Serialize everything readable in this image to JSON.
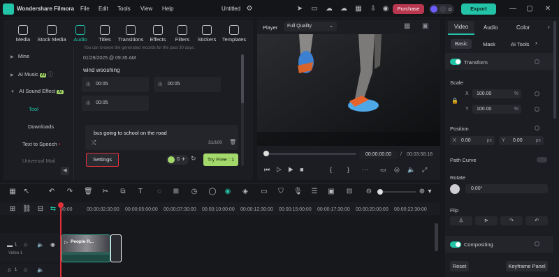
{
  "app": {
    "name": "Wondershare Filmora",
    "title": "Untitled"
  },
  "menu": [
    "File",
    "Edit",
    "Tools",
    "View",
    "Help"
  ],
  "header": {
    "purchase": "Purchase",
    "credits": "0",
    "export": "Export"
  },
  "media_nav": [
    "Media",
    "Stock Media",
    "Audio",
    "Titles",
    "Transitions",
    "Effects",
    "Filters",
    "Stickers",
    "Templates"
  ],
  "sidebar": {
    "items": [
      {
        "label": "Mine"
      },
      {
        "label": "AI Music",
        "badge": "AI"
      },
      {
        "label": "AI Sound Effect",
        "badge": "AI"
      },
      {
        "label": "Tool"
      },
      {
        "label": "Downloads"
      },
      {
        "label": "Text to Speech"
      },
      {
        "label": "Universal Mail"
      }
    ]
  },
  "content": {
    "note": "You can browse the generated records for the past 30 days.",
    "date": "01/29/2025 @ 09:35 AM",
    "record_title": "wind wooshing",
    "clips": [
      "00:05",
      "00:05",
      "00:05"
    ],
    "prompt": "bus going to school on the road",
    "counter": "31/100",
    "settings": "Settings",
    "credit_cost": "0",
    "try_free": "Try Free : 1"
  },
  "player": {
    "label": "Player",
    "quality": "Full Quality",
    "current_time": "00:00:00:00",
    "separator": "/",
    "duration": "00:03:58:18"
  },
  "right_panel": {
    "tabs": [
      "Video",
      "Audio",
      "Color"
    ],
    "subtabs": [
      "Basic",
      "Mask",
      "AI Tools"
    ],
    "transform": "Transform",
    "scale": "Scale",
    "scale_x_label": "X",
    "scale_y_label": "Y",
    "scale_x": "100.00",
    "scale_y": "100.00",
    "percent": "%",
    "position": "Position",
    "pos_x_label": "X",
    "pos_y_label": "Y",
    "pos_x": "0.00",
    "pos_y": "0.00",
    "px": "px",
    "path_curve": "Path Curve",
    "rotate": "Rotate",
    "rotate_value": "0.00°",
    "flip": "Flip",
    "compositing": "Compositing",
    "reset": "Reset",
    "keyframe": "Keyframe Panel"
  },
  "timeline": {
    "ruler": [
      "00:00",
      "00:00:02:30:00",
      "00:00:05:00:00",
      "00:00:07:30:00",
      "00:00:10:00:00",
      "00:00:12:30:00",
      "00:00:15:00:00",
      "00:00:17:30:00",
      "00:00:20:00:00",
      "00:00:22:30:00"
    ],
    "clip_title": "People R...",
    "video_track": "Video 1",
    "track1": "1",
    "track2": "1"
  },
  "colors": {
    "accent": "#22c3a6",
    "badge": "#a3d86b",
    "purchase": "#b8364e",
    "highlight_border": "#e0313a"
  }
}
